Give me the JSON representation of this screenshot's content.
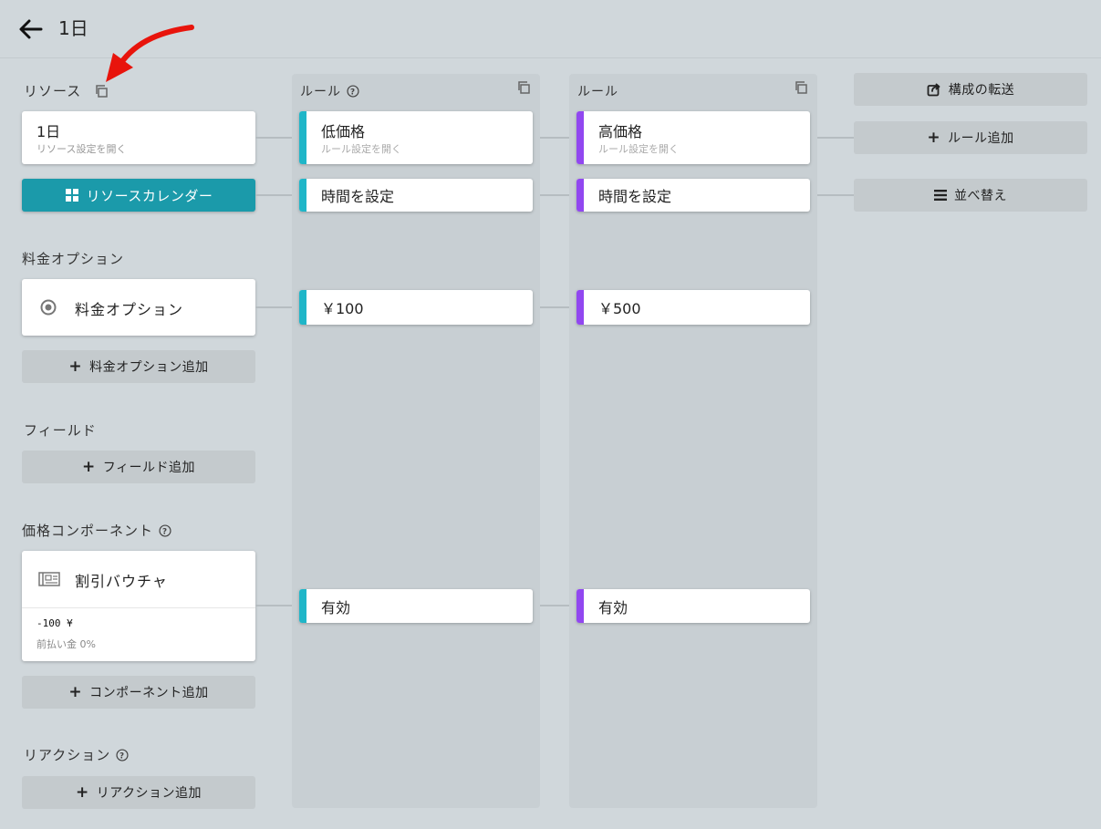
{
  "header": {
    "title": "1日"
  },
  "colors": {
    "teal": "#1b9aaa",
    "cyan_bar": "#1fb6c8",
    "purple_bar": "#9147f0",
    "background": "#d0d7db",
    "red_arrow": "#e8140c"
  },
  "left": {
    "resources_label": "リソース",
    "resource_card": {
      "title": "1日",
      "subtitle": "リソース設定を開く"
    },
    "calendar_button": "リソースカレンダー",
    "price_options_label": "料金オプション",
    "price_option_card": {
      "title": "料金オプション"
    },
    "add_price_option": "料金オプション追加",
    "fields_label": "フィールド",
    "add_field": "フィールド追加",
    "price_components_label": "価格コンポーネント",
    "component_card": {
      "title": "割引バウチャ",
      "amount": "-100 ¥",
      "prepay": "前払い金 0%"
    },
    "add_component": "コンポーネント追加",
    "reactions_label": "リアクション",
    "add_reaction": "リアクション追加"
  },
  "rules": [
    {
      "header": "ルール",
      "name": "低価格",
      "subtitle": "ルール設定を開く",
      "time": "時間を設定",
      "price": "￥100",
      "component": "有効"
    },
    {
      "header": "ルール",
      "name": "高価格",
      "subtitle": "ルール設定を開く",
      "time": "時間を設定",
      "price": "￥500",
      "component": "有効"
    }
  ],
  "actions": {
    "transfer": "構成の転送",
    "add_rule": "ルール追加",
    "sort": "並べ替え"
  }
}
